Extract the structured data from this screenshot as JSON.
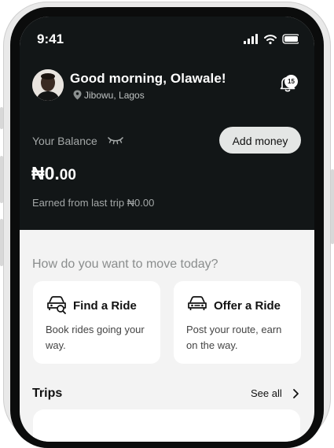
{
  "status_bar": {
    "time": "9:41"
  },
  "user": {
    "greeting": "Good morning, Olawale!",
    "location": "Jibowu, Lagos",
    "notification_count": "15"
  },
  "balance": {
    "label": "Your Balance",
    "add_money_label": "Add money",
    "amount_main": "₦0.",
    "amount_decimal": "00",
    "earned_text": "Earned from last trip ₦0.00"
  },
  "move": {
    "prompt": "How do you want to move today?",
    "cards": [
      {
        "title": "Find a Ride",
        "description": "Book rides going your way.",
        "icon": "car-search-icon"
      },
      {
        "title": "Offer a Ride",
        "description": "Post your route, earn on the way.",
        "icon": "car-icon"
      }
    ]
  },
  "trips": {
    "title": "Trips",
    "see_all_label": "See all"
  },
  "colors": {
    "dark_header": "#121617",
    "surface": "#f3f3f3",
    "card": "#ffffff",
    "muted_text": "#a4a8a8"
  }
}
